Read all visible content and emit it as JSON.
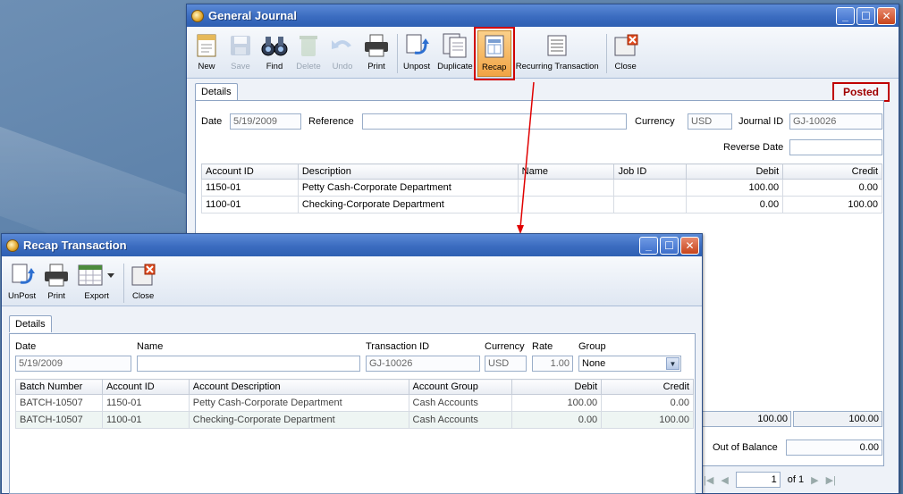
{
  "gj": {
    "title": "General Journal",
    "toolbar": [
      {
        "label": "New",
        "icon": "new-doc-icon",
        "enabled": true
      },
      {
        "label": "Save",
        "icon": "save-disk-icon",
        "enabled": false
      },
      {
        "label": "Find",
        "icon": "binoculars-icon",
        "enabled": true
      },
      {
        "label": "Delete",
        "icon": "recycle-bin-icon",
        "enabled": false
      },
      {
        "label": "Undo",
        "icon": "undo-arrow-icon",
        "enabled": false
      },
      {
        "label": "Print",
        "icon": "printer-icon",
        "enabled": true
      },
      {
        "label": "Unpost",
        "icon": "unpost-icon",
        "enabled": true
      },
      {
        "label": "Duplicate",
        "icon": "duplicate-icon",
        "enabled": true
      },
      {
        "label": "Recap",
        "icon": "recap-icon",
        "enabled": true
      },
      {
        "label": "Recurring Transaction",
        "icon": "recurring-icon",
        "enabled": true
      },
      {
        "label": "Close",
        "icon": "close-doc-icon",
        "enabled": true
      }
    ],
    "tab": "Details",
    "status": "Posted",
    "date_label": "Date",
    "date": "5/19/2009",
    "reference_label": "Reference",
    "reference": "",
    "currency_label": "Currency",
    "currency": "USD",
    "journal_id_label": "Journal ID",
    "journal_id": "GJ-10026",
    "reverse_date_label": "Reverse Date",
    "reverse_date": "",
    "columns": [
      "Account ID",
      "Description",
      "Name",
      "Job ID",
      "Debit",
      "Credit"
    ],
    "rows": [
      [
        "1150-01",
        "Petty Cash-Corporate Department",
        "",
        "",
        "100.00",
        "0.00"
      ],
      [
        "1100-01",
        "Checking-Corporate Department",
        "",
        "",
        "0.00",
        "100.00"
      ]
    ],
    "total_debit": "100.00",
    "total_credit": "100.00",
    "out_of_balance_label": "Out of Balance",
    "out_of_balance": "0.00",
    "page": "1",
    "page_of": "of 1"
  },
  "recap": {
    "title": "Recap Transaction",
    "toolbar": [
      {
        "label": "UnPost",
        "icon": "unpost-icon"
      },
      {
        "label": "Print",
        "icon": "printer-icon"
      },
      {
        "label": "Export",
        "icon": "export-icon"
      },
      {
        "label": "Close",
        "icon": "close-doc-icon"
      }
    ],
    "tab": "Details",
    "date_label": "Date",
    "date": "5/19/2009",
    "name_label": "Name",
    "name": "",
    "txn_label": "Transaction ID",
    "txn": "GJ-10026",
    "currency_label": "Currency",
    "currency": "USD",
    "rate_label": "Rate",
    "rate": "1.00",
    "group_label": "Group",
    "group": "None",
    "columns": [
      "Batch Number",
      "Account ID",
      "Account Description",
      "Account Group",
      "Debit",
      "Credit"
    ],
    "rows": [
      [
        "BATCH-10507",
        "1150-01",
        "Petty Cash-Corporate Department",
        "Cash Accounts",
        "100.00",
        "0.00"
      ],
      [
        "BATCH-10507",
        "1100-01",
        "Checking-Corporate Department",
        "Cash Accounts",
        "0.00",
        "100.00"
      ]
    ]
  }
}
